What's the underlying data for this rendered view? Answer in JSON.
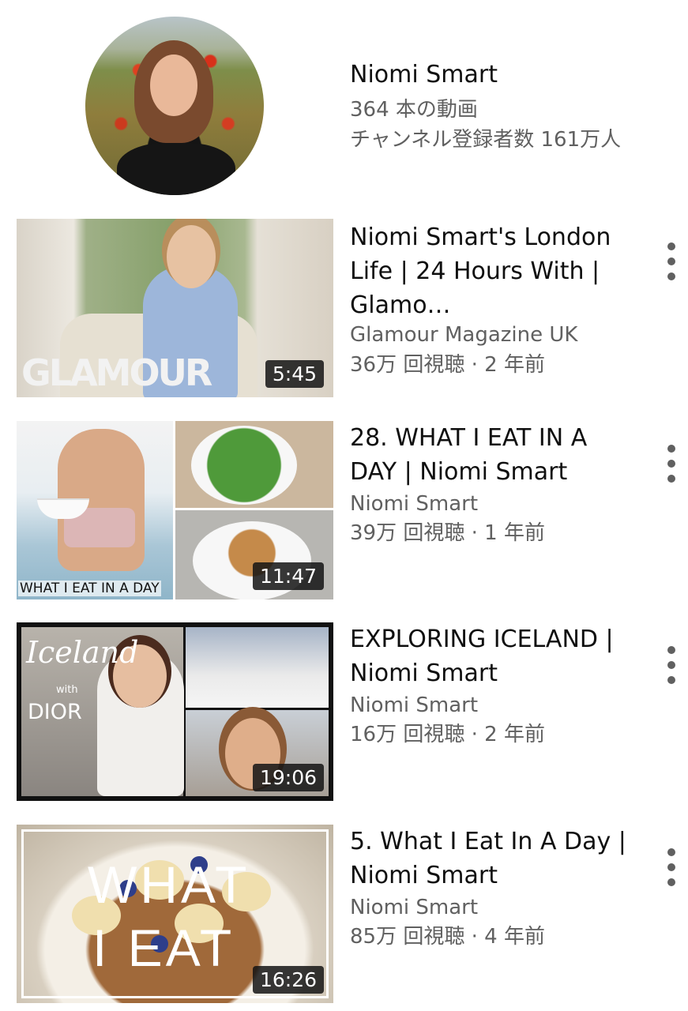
{
  "channel": {
    "name": "Niomi Smart",
    "videos": "364 本の動画",
    "subscribers": "チャンネル登録者数 161万人"
  },
  "videos": [
    {
      "title": "Niomi Smart's London Life | 24 Hours With | Glamo…",
      "channel": "Glamour Magazine UK",
      "meta": "36万 回視聴 · 2 年前",
      "duration": "5:45",
      "thumb_text": "GLAMOUR"
    },
    {
      "title": "28. WHAT I EAT IN A DAY | Niomi Smart",
      "channel": "Niomi Smart",
      "meta": "39万 回視聴 · 1 年前",
      "duration": "11:47",
      "thumb_text": "WHAT I EAT IN A DAY"
    },
    {
      "title": "EXPLORING ICELAND | Niomi Smart",
      "channel": "Niomi Smart",
      "meta": "16万 回視聴 · 2 年前",
      "duration": "19:06",
      "thumb_text": {
        "iceland": "Iceland",
        "with": "with",
        "dior": "DIOR"
      }
    },
    {
      "title": "5. What I Eat In A Day | Niomi Smart",
      "channel": "Niomi Smart",
      "meta": "85万 回視聴 · 4 年前",
      "duration": "16:26",
      "thumb_text": {
        "line1": "WHAT",
        "line2": "I EAT"
      }
    }
  ],
  "icons": {
    "more": "more-vert-icon"
  }
}
